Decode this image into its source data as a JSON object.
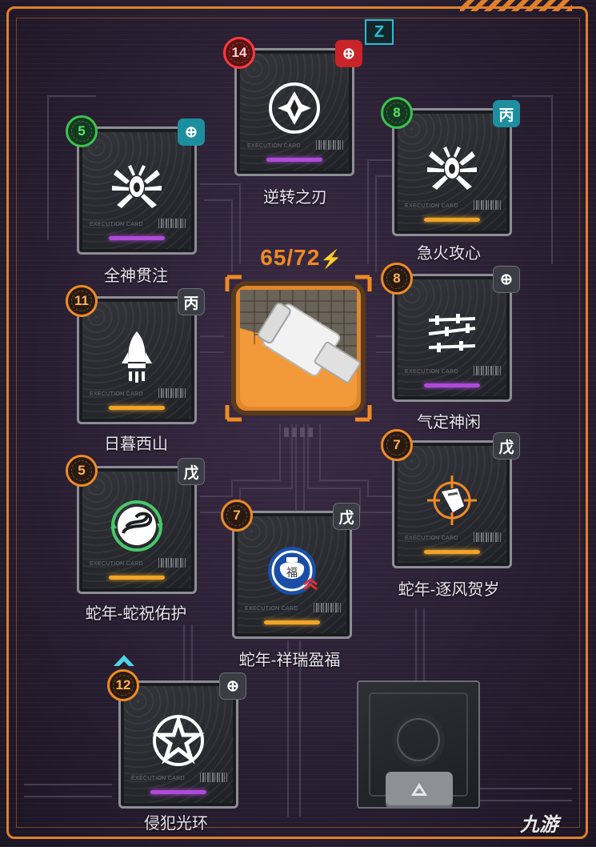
{
  "energy": {
    "text": "65/72",
    "icon": "lightning-icon"
  },
  "top_badge": {
    "text": "Z",
    "color": "#28c0d0"
  },
  "center_item": {
    "icon": "usb-stick-icon"
  },
  "card_caption": "EXECUTION CARD",
  "cards": [
    {
      "name": "逆转之刃",
      "cost": "14",
      "cost_color": "red",
      "slot_glyph": "⊕",
      "slot_color": "red",
      "rarity": "purple",
      "emblem": "diamond-circle-icon"
    },
    {
      "name": "全神贯注",
      "cost": "5",
      "cost_color": "green",
      "slot_glyph": "⊕",
      "slot_color": "teal",
      "rarity": "purple",
      "emblem": "spider-icon"
    },
    {
      "name": "急火攻心",
      "cost": "8",
      "cost_color": "green",
      "slot_glyph": "丙",
      "slot_color": "teal",
      "rarity": "gold",
      "emblem": "spider-icon"
    },
    {
      "name": "日暮西山",
      "cost": "11",
      "cost_color": "orange",
      "slot_glyph": "丙",
      "slot_color": "grey",
      "rarity": "gold",
      "emblem": "rocket-icon"
    },
    {
      "name": "气定神闲",
      "cost": "8",
      "cost_color": "orange",
      "slot_glyph": "⊕",
      "slot_color": "grey",
      "rarity": "purple",
      "emblem": "barbed-wire-icon"
    },
    {
      "name": "蛇年-蛇祝佑护",
      "cost": "5",
      "cost_color": "orange",
      "slot_glyph": "戊",
      "slot_color": "grey",
      "rarity": "gold",
      "emblem": "snake-circle-icon"
    },
    {
      "name": "蛇年-逐风贺岁",
      "cost": "7",
      "cost_color": "orange",
      "slot_glyph": "戊",
      "slot_color": "grey",
      "rarity": "gold",
      "emblem": "crosshair-icon"
    },
    {
      "name": "蛇年-祥瑞盈福",
      "cost": "7",
      "cost_color": "orange",
      "slot_glyph": "戊",
      "slot_color": "grey",
      "rarity": "gold",
      "emblem": "fortune-bag-icon"
    },
    {
      "name": "侵犯光环",
      "cost": "12",
      "cost_color": "orange",
      "slot_glyph": "⊕",
      "slot_color": "grey",
      "rarity": "purple",
      "emblem": "star-circle-icon"
    }
  ],
  "watermark": "九游"
}
